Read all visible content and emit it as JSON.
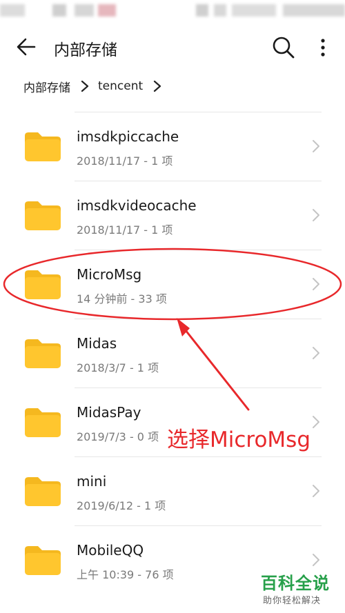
{
  "appbar": {
    "title": "内部存储"
  },
  "breadcrumb": [
    "内部存储",
    "tencent"
  ],
  "folders": [
    {
      "name": "imsdkpiccache",
      "meta": "2018/11/17 - 1 项"
    },
    {
      "name": "imsdkvideocache",
      "meta": "2018/11/17 - 1 项"
    },
    {
      "name": "MicroMsg",
      "meta": "14 分钟前 - 33 项"
    },
    {
      "name": "Midas",
      "meta": "2018/3/7 - 1 项"
    },
    {
      "name": "MidasPay",
      "meta": "2019/7/3 - 0 项"
    },
    {
      "name": "mini",
      "meta": "2019/6/12 - 1 项"
    },
    {
      "name": "MobileQQ",
      "meta": "上午 10:39 - 76 项"
    }
  ],
  "annotation": {
    "text": "选择MicroMsg",
    "color": "#e8282b"
  },
  "watermark": {
    "title": "百科全说",
    "subtitle": "助你轻松解决"
  },
  "colors": {
    "folder": "#ffc62e",
    "folder_tab": "#f5b81f",
    "watermark_green": "#27a04a"
  },
  "icons": {
    "back": "arrow-left-icon",
    "search": "search-icon",
    "more": "more-vertical-icon",
    "folder": "folder-icon",
    "chevron": "chevron-right-icon"
  }
}
